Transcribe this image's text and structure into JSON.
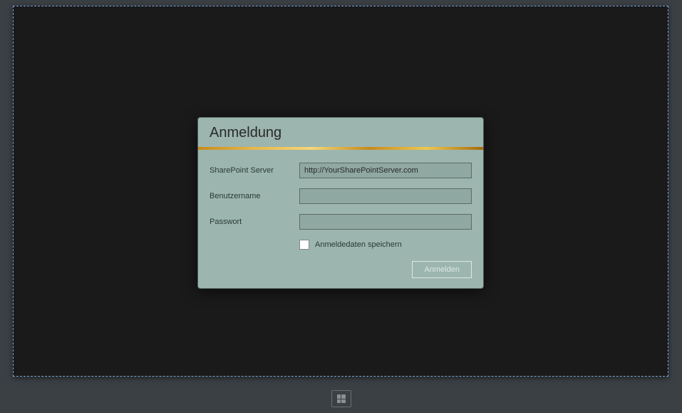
{
  "dialog": {
    "title": "Anmeldung",
    "fields": {
      "server": {
        "label": "SharePoint Server",
        "value": "http://YourSharePointServer.com"
      },
      "username": {
        "label": "Benutzername",
        "value": ""
      },
      "password": {
        "label": "Passwort",
        "value": ""
      }
    },
    "remember": {
      "label": "Anmeldedaten speichern",
      "checked": false
    },
    "submit_label": "Anmelden"
  }
}
